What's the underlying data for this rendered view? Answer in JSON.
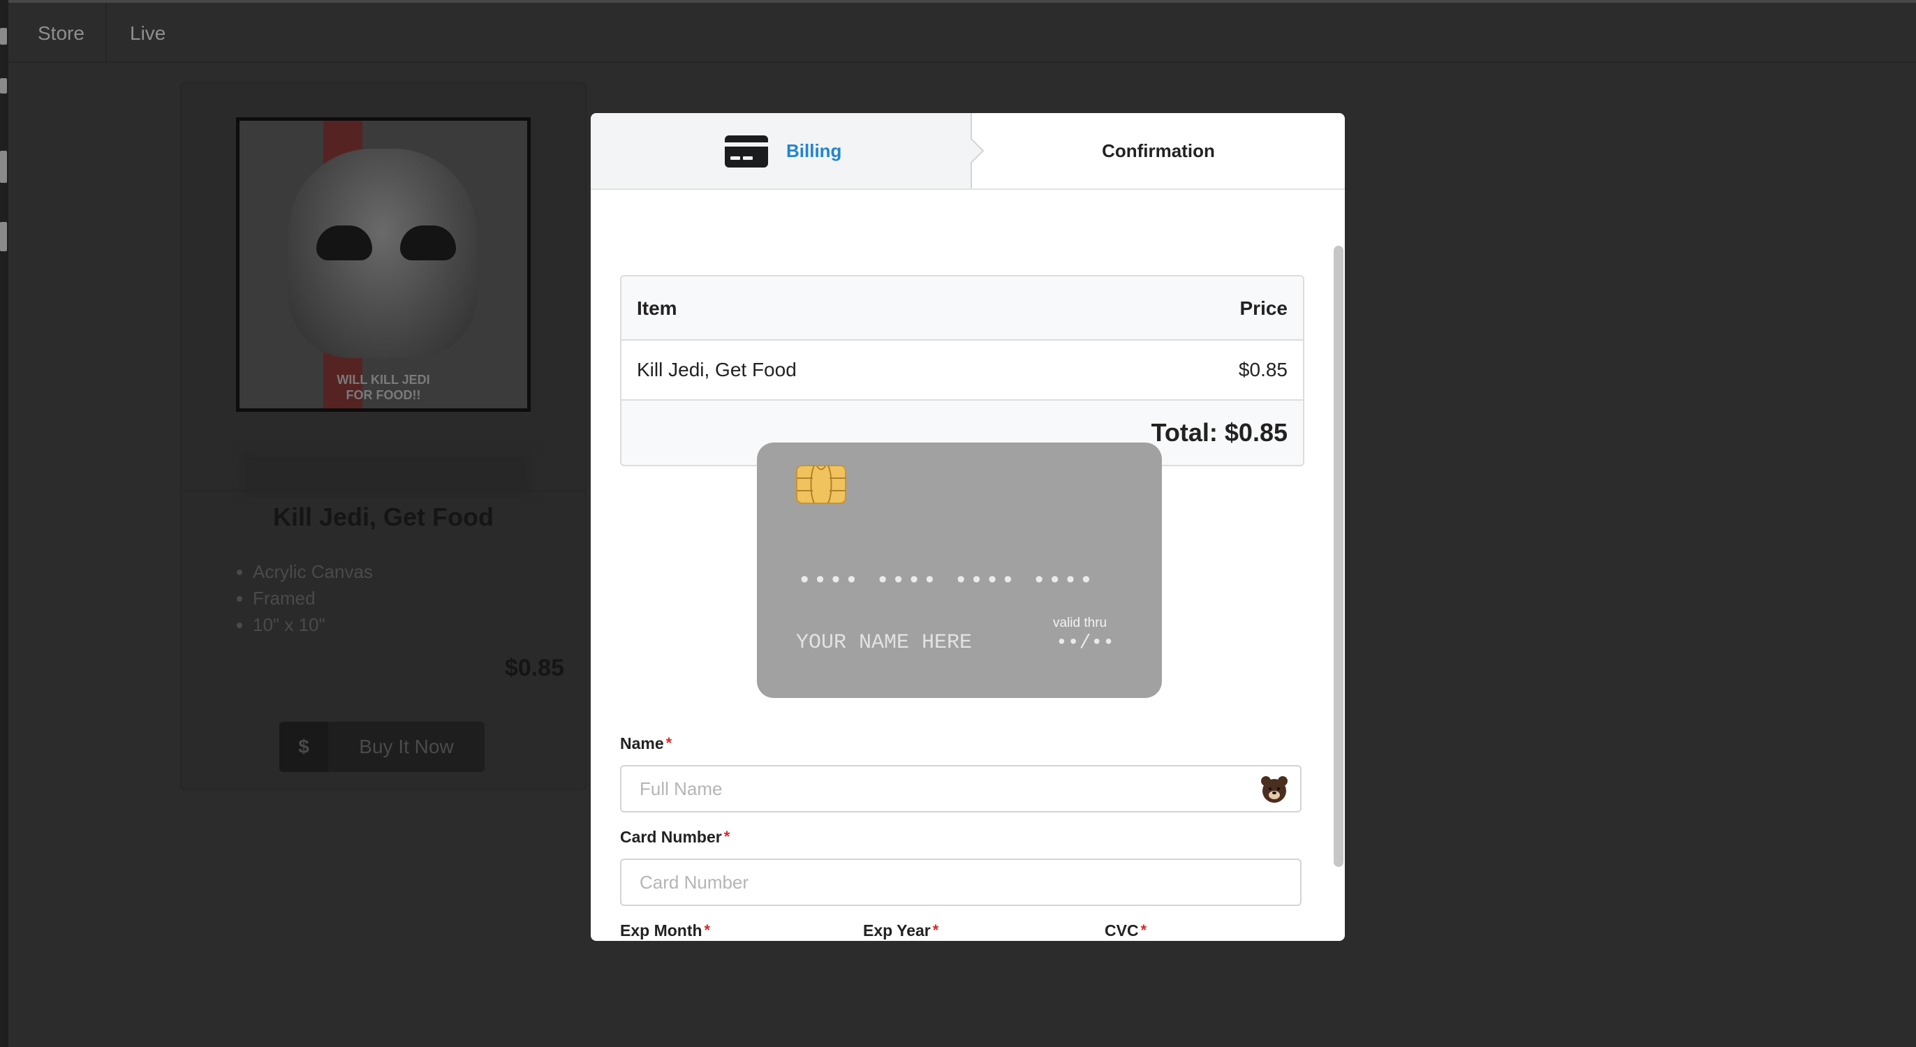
{
  "nav": {
    "items": [
      "Store",
      "Live"
    ]
  },
  "product": {
    "poster_caption_line1": "WILL KILL JEDI",
    "poster_caption_line2": "FOR FOOD!!",
    "title": "Kill Jedi, Get Food",
    "features": [
      "Acrylic Canvas",
      "Framed",
      "10\" x 10\""
    ],
    "price": "$0.85",
    "buy_symbol": "$",
    "buy_label": "Buy It Now"
  },
  "modal": {
    "steps": {
      "billing": "Billing",
      "confirmation": "Confirmation"
    },
    "table": {
      "headers": {
        "item": "Item",
        "price": "Price"
      },
      "rows": [
        {
          "item": "Kill Jedi, Get Food",
          "price": "$0.85"
        }
      ],
      "total": "Total: $0.85"
    },
    "card_preview": {
      "number": "•••• •••• •••• ••••",
      "name": "YOUR NAME HERE",
      "valid_thru": "valid thru",
      "expiry": "••/••"
    },
    "form": {
      "name_label": "Name",
      "name_placeholder": "Full Name",
      "card_number_label": "Card Number",
      "card_number_placeholder": "Card Number",
      "exp_month_label": "Exp Month",
      "exp_year_label": "Exp Year",
      "cvc_label": "CVC",
      "required_mark": "*"
    }
  },
  "colors": {
    "accent": "#2185d0",
    "required": "#db2828",
    "card_bg": "#a1a1a1",
    "overlay_bg": "#2c2c2c"
  }
}
